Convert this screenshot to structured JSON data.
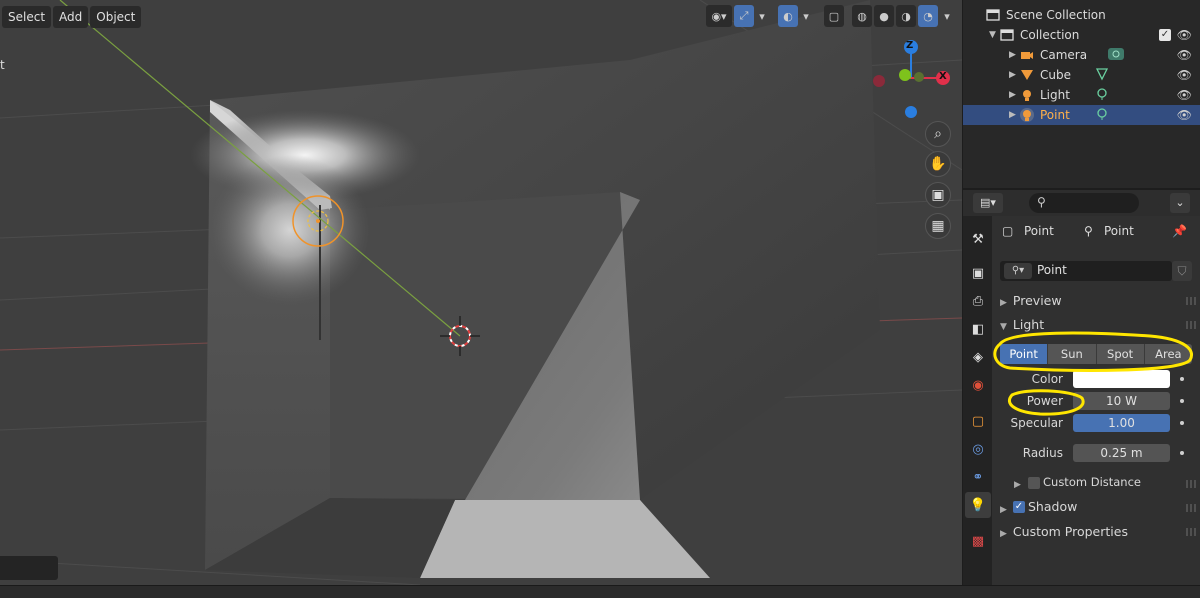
{
  "header": {
    "menu": [
      "Select",
      "Add",
      "Object"
    ],
    "left_clip_text": "t"
  },
  "outliner": {
    "scene_collection": "Scene Collection",
    "collection": "Collection",
    "items": [
      {
        "label": "Camera",
        "icon": "camera-icon"
      },
      {
        "label": "Cube",
        "icon": "mesh-icon"
      },
      {
        "label": "Light",
        "icon": "light-icon"
      },
      {
        "label": "Point",
        "icon": "light-icon",
        "selected": true
      }
    ]
  },
  "properties": {
    "search_placeholder": "",
    "breadcrumb": [
      "Point",
      "Point"
    ],
    "datablock_name": "Point",
    "sections": {
      "preview": "Preview",
      "light": "Light",
      "custom_distance": "Custom Distance",
      "shadow": "Shadow",
      "custom_properties": "Custom Properties"
    },
    "light_types": [
      "Point",
      "Sun",
      "Spot",
      "Area"
    ],
    "active_light_type": "Point",
    "fields": {
      "color_label": "Color",
      "color_value": "#ffffff",
      "power_label": "Power",
      "power_value": "10 W",
      "specular_label": "Specular",
      "specular_value": "1.00",
      "radius_label": "Radius",
      "radius_value": "0.25 m"
    },
    "shadow_enabled": true,
    "custom_distance_enabled": false
  },
  "colors": {
    "accent": "#4772b3",
    "selection": "#334d80",
    "selected_text": "#ffb04a",
    "annotation": "#ffe600",
    "axis_x": "#e0304a",
    "axis_y": "#7ec21c",
    "axis_z": "#2a7ee0"
  },
  "gizmo_axes": [
    "Z",
    "X"
  ]
}
